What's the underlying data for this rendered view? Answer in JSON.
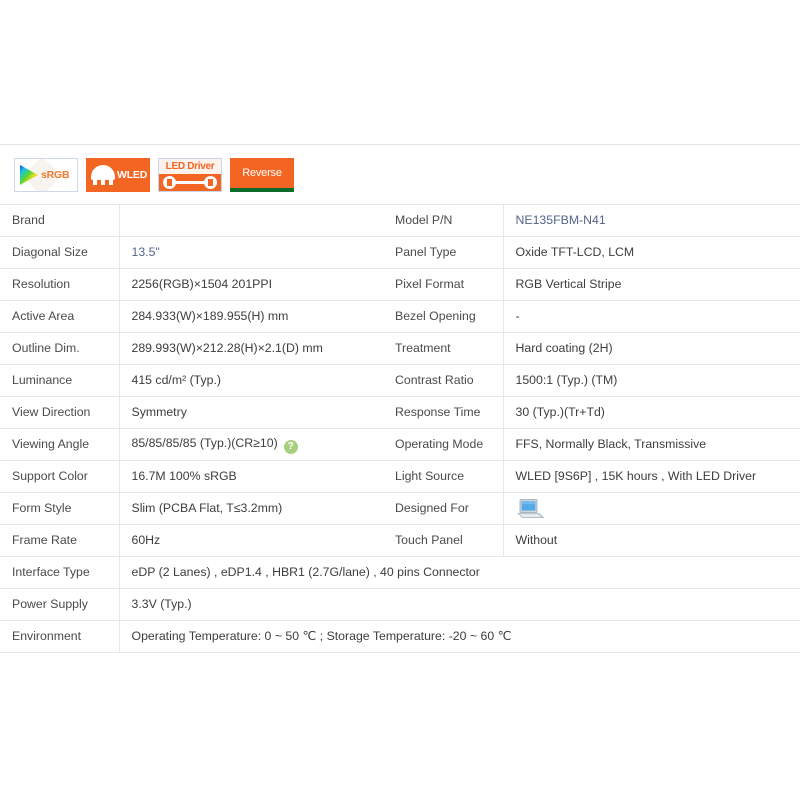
{
  "badges": [
    {
      "id": "srgb-badge",
      "label": "sRGB",
      "style": "srgb"
    },
    {
      "id": "wled-badge",
      "label": "WLED",
      "style": "wled"
    },
    {
      "id": "led-driver-badge",
      "label": "LED Driver",
      "style": "leddriver"
    },
    {
      "id": "reverse-badge",
      "label": "Reverse",
      "style": "reverse"
    }
  ],
  "colors": {
    "orange": "#f26522",
    "srgb_text": "#f07b2e",
    "accent_blue": "#53648a",
    "label_gray": "#4a4a4a",
    "value_gray": "#3d3d3d",
    "border": "#e8e8e8",
    "help_green": "#a8cf7e",
    "reverse_bar_green": "#0a6b2a"
  },
  "spec": {
    "rows": [
      {
        "left_label": "Brand",
        "left_value": "",
        "right_label": "Model P/N",
        "right_value": "NE135FBM-N41",
        "right_accent": true
      },
      {
        "left_label": "Diagonal Size",
        "left_value": "13.5\"",
        "left_accent": true,
        "right_label": "Panel Type",
        "right_value": "Oxide TFT-LCD, LCM"
      },
      {
        "left_label": "Resolution",
        "left_value": "2256(RGB)×1504  201PPI",
        "right_label": "Pixel Format",
        "right_value": "RGB Vertical Stripe"
      },
      {
        "left_label": "Active Area",
        "left_value": "284.933(W)×189.955(H) mm",
        "right_label": "Bezel Opening",
        "right_value": "-"
      },
      {
        "left_label": "Outline Dim.",
        "left_value": "289.993(W)×212.28(H)×2.1(D) mm",
        "right_label": "Treatment",
        "right_value": "Hard coating (2H)"
      },
      {
        "left_label": "Luminance",
        "left_value": "415 cd/m² (Typ.)",
        "right_label": "Contrast Ratio",
        "right_value": "1500:1 (Typ.) (TM)"
      },
      {
        "left_label": "View Direction",
        "left_value": "Symmetry",
        "right_label": "Response Time",
        "right_value": "30 (Typ.)(Tr+Td)"
      },
      {
        "left_label": "Viewing Angle",
        "left_value": "85/85/85/85 (Typ.)(CR≥10)",
        "left_help": "?",
        "right_label": "Operating Mode",
        "right_value": "FFS, Normally Black, Transmissive"
      },
      {
        "left_label": "Support Color",
        "left_value": "16.7M   100% sRGB",
        "right_label": "Light Source",
        "right_value": "WLED  [9S6P] , 15K hours , With LED Driver"
      },
      {
        "left_label": "Form Style",
        "left_value": "Slim (PCBA Flat, T≤3.2mm)",
        "right_label": "Designed For",
        "right_value": "",
        "right_icon": "laptop-icon"
      },
      {
        "left_label": "Frame Rate",
        "left_value": "60Hz",
        "right_label": "Touch Panel",
        "right_value": "Without"
      }
    ],
    "wide_rows": [
      {
        "label": "Interface Type",
        "value": "eDP (2 Lanes) , eDP1.4 , HBR1 (2.7G/lane) , 40 pins Connector"
      },
      {
        "label": "Power Supply",
        "value": "3.3V (Typ.)"
      },
      {
        "label": "Environment",
        "value": "Operating Temperature: 0 ~ 50 ℃ ; Storage Temperature: -20 ~ 60 ℃"
      }
    ]
  }
}
